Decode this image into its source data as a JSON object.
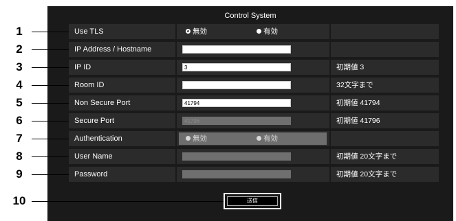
{
  "title": "Control System",
  "rows": [
    {
      "num": "1",
      "label": "Use TLS",
      "type": "radio",
      "options": [
        "無効",
        "有効"
      ],
      "selected": 0,
      "note": ""
    },
    {
      "num": "2",
      "label": "IP Address / Hostname",
      "type": "input",
      "value": "",
      "note": ""
    },
    {
      "num": "3",
      "label": "IP ID",
      "type": "input",
      "value": "3",
      "note": "初期値 3"
    },
    {
      "num": "4",
      "label": "Room ID",
      "type": "input",
      "value": "",
      "note": "32文字まで"
    },
    {
      "num": "5",
      "label": "Non Secure Port",
      "type": "input",
      "value": "41794",
      "note": "初期値 41794"
    },
    {
      "num": "6",
      "label": "Secure Port",
      "type": "input-disabled",
      "value": "41796",
      "note": "初期値 41796"
    },
    {
      "num": "7",
      "label": "Authentication",
      "type": "radio-disabled",
      "options": [
        "無効",
        "有効"
      ],
      "selected": 0,
      "note": ""
    },
    {
      "num": "8",
      "label": "User Name",
      "type": "input-disabled",
      "value": "",
      "note": "初期値 20文字まで"
    },
    {
      "num": "9",
      "label": "Password",
      "type": "input-disabled",
      "value": "",
      "note": "初期値 20文字まで"
    }
  ],
  "submit": {
    "num": "10",
    "label": "送信"
  },
  "colors": {
    "panel": "#1a1a1a",
    "cell": "#2b2b2b",
    "disabled": "#6f6f6f"
  }
}
